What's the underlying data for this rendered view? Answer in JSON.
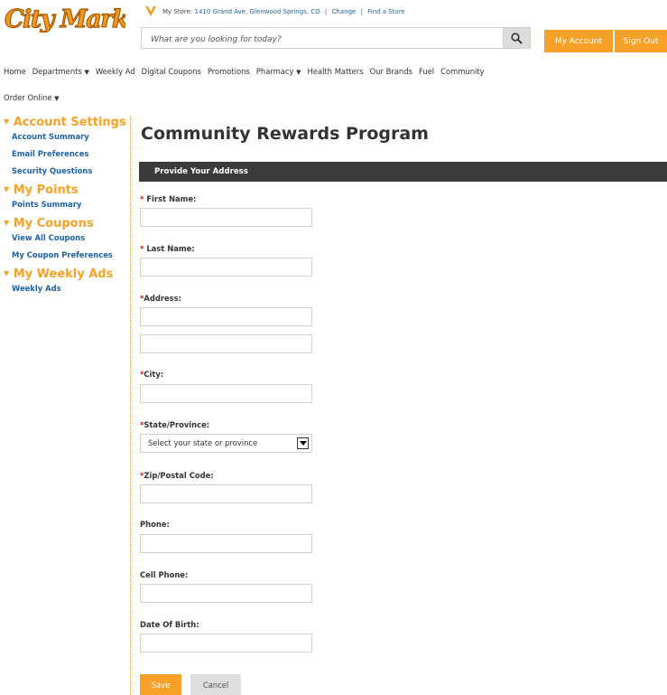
{
  "header": {
    "logo_text": "City Market",
    "store_prefix": "My Store:",
    "store_address": "1410 Grand Ave, Glenwood Springs, CO",
    "change_link": "Change",
    "find_store_link": "Find a Store",
    "separator": "|",
    "search_placeholder": "What are you looking for today?",
    "my_account": "My Account",
    "sign_out": "Sign Out"
  },
  "nav": {
    "items": [
      "Home",
      "Departments",
      "Weekly Ad",
      "Digital Coupons",
      "Promotions",
      "Pharmacy",
      "Health Matters",
      "Our Brands",
      "Fuel",
      "Community"
    ],
    "second_row": "Order Online",
    "caret": "▼"
  },
  "sidebar": {
    "tri": "▼",
    "sections": [
      {
        "title": "Account Settings",
        "links": [
          "Account Summary",
          "Email Preferences",
          "Security Questions"
        ]
      },
      {
        "title": "My Points",
        "links": [
          "Points Summary"
        ]
      },
      {
        "title": "My Coupons",
        "links": [
          "View All Coupons",
          "My Coupon Preferences"
        ]
      },
      {
        "title": "My Weekly Ads",
        "links": [
          "Weekly Ads"
        ]
      }
    ]
  },
  "main": {
    "title": "Community Rewards Program",
    "section_header": "Provide Your Address",
    "required_mark": "*",
    "fields": {
      "first_name": "First Name:",
      "last_name": "Last Name:",
      "address": "Address:",
      "city": "City:",
      "state": "State/Province:",
      "zip": "Zip/Postal Code:",
      "phone": "Phone:",
      "cell_phone": "Cell Phone:",
      "dob": "Date Of Birth:"
    },
    "state_select_value": "Select your state or province",
    "save": "Save",
    "cancel": "Cancel"
  },
  "colors": {
    "accent": "#f7a128",
    "link": "#1f62a6",
    "required": "#c8102e",
    "bar": "#3b3b3b"
  }
}
